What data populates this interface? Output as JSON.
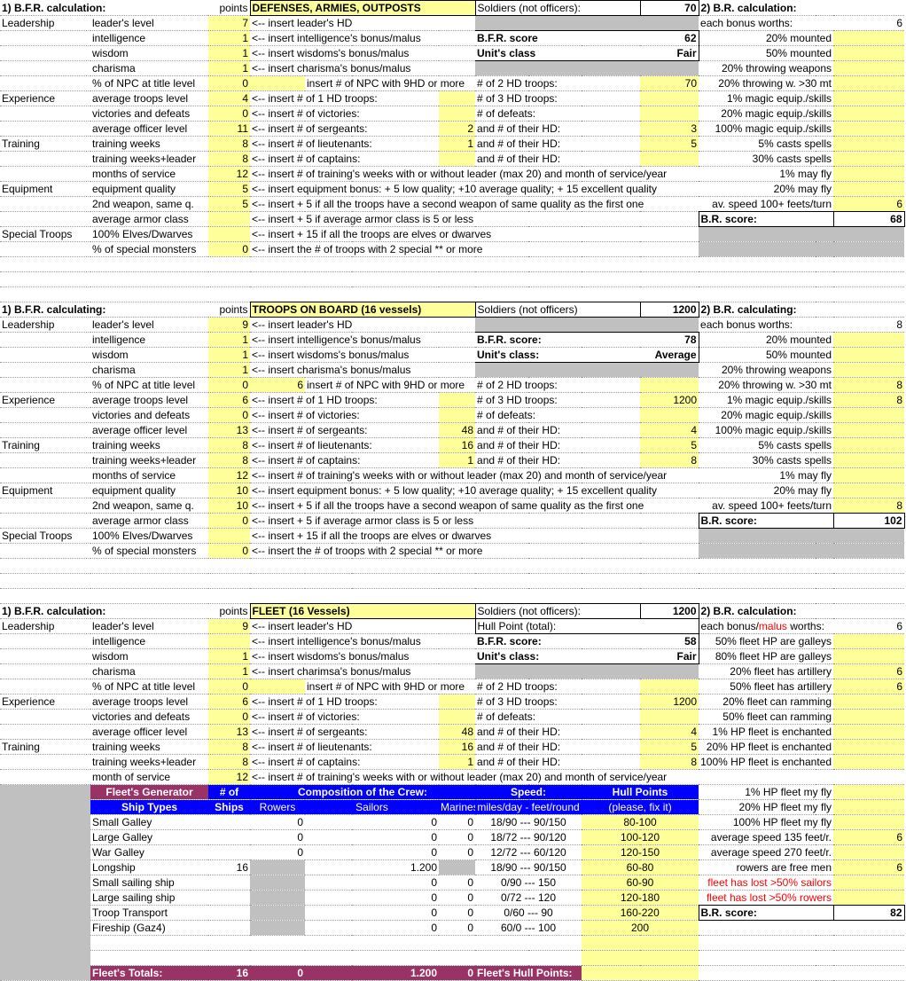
{
  "sections": [
    {
      "title": "1) B.F.R. calculation:",
      "points_label": "points",
      "heading": "DEFENSES, ARMIES, OUTPOSTS",
      "soldiers_label": "Soldiers (not officers):",
      "soldiers": "70",
      "br_title": "2) B.R. calculation:",
      "bonus_label": "each bonus worths:",
      "bonus_value": "6",
      "bfr_score_label": "B.F.R. score",
      "bfr_score": "62",
      "unit_class_label": "Unit's class",
      "unit_class": "Fair",
      "rows": [
        {
          "cat": "Leadership",
          "item": "leader's level",
          "pts": "7",
          "ins": "<-- insert leader's HD",
          "mid_l": "",
          "mid_v": "",
          "br_l": "",
          "br_v": ""
        },
        {
          "cat": "",
          "item": "intelligence",
          "pts": "1",
          "ins": "<-- insert intelligence's bonus/malus",
          "br_l": "20% mounted",
          "br_v": ""
        },
        {
          "cat": "",
          "item": "wisdom",
          "pts": "1",
          "ins": "<-- insert wisdoms's bonus/malus",
          "br_l": "50% mounted",
          "br_v": ""
        },
        {
          "cat": "",
          "item": "charisma",
          "pts": "1",
          "ins": "<-- insert charisma's bonus/malus",
          "br_l": "20% throwing weapons",
          "br_v": ""
        },
        {
          "cat": "",
          "item": "% of NPC at title level",
          "pts": "0",
          "ins_v": "",
          "ins": "insert # of NPC with 9HD or more",
          "mid_l": "# of 2 HD troops:",
          "mid_v": "70",
          "br_l": "20% throwing w. >30 mt",
          "br_v": ""
        },
        {
          "cat": "Experience",
          "item": "average troops level",
          "pts": "4",
          "ins": "<-- insert # of 1 HD troops:",
          "ins_v": "",
          "mid_l": "# of 3 HD troops:",
          "mid_v": "",
          "br_l": "1% magic equip./skills",
          "br_v": ""
        },
        {
          "cat": "",
          "item": "victories and defeats",
          "pts": "0",
          "ins": "<-- insert # of victories:",
          "ins_v": "",
          "mid_l": "# of defeats:",
          "mid_v": "",
          "br_l": "20% magic equip./skills",
          "br_v": ""
        },
        {
          "cat": "",
          "item": "average officer level",
          "pts": "11",
          "ins": "<-- insert # of sergeants:",
          "ins_v": "2",
          "mid_l": "and # of their HD:",
          "mid_v": "3",
          "br_l": "100% magic equip./skills",
          "br_v": ""
        },
        {
          "cat": "Training",
          "item": "training weeks",
          "pts": "8",
          "ins": "<-- insert # of lieutenants:",
          "ins_v": "1",
          "mid_l": "and # of their HD:",
          "mid_v": "5",
          "br_l": "5% casts spells",
          "br_v": ""
        },
        {
          "cat": "",
          "item": "training weeks+leader",
          "pts": "8",
          "ins": "<-- insert # of captains:",
          "ins_v": "",
          "mid_l": "and # of their HD:",
          "mid_v": "",
          "br_l": "30% casts spells",
          "br_v": ""
        },
        {
          "cat": "",
          "item": "months of service",
          "pts": "12",
          "long": "<-- insert # of training's weeks with or without leader (max 20) and month of service/year",
          "br_l": "1% may fly",
          "br_v": ""
        },
        {
          "cat": "Equipment",
          "item": "equipment quality",
          "pts": "5",
          "long": "<-- insert equipment bonus: + 5 low quality; +10 average quality; + 15 excellent quality",
          "br_l": "20% may fly",
          "br_v": ""
        },
        {
          "cat": "",
          "item": "2nd weapon, same q.",
          "pts": "5",
          "long": "<-- insert + 5 if all the troops have a second weapon of same quality as the first one",
          "br_l": "av. speed 100+ feets/turn",
          "br_v": "6"
        },
        {
          "cat": "",
          "item": "average armor class",
          "pts": "",
          "long": "<-- insert + 5 if average armor class is 5 or less",
          "br_l": "B.R. score:",
          "br_v": "68"
        },
        {
          "cat": "Special Troops",
          "item": "100% Elves/Dwarves",
          "pts": "",
          "long": "<-- insert + 15 if all the troops are elves or dwarves"
        },
        {
          "cat": "",
          "item": "% of special monsters",
          "pts": "0",
          "long": "<-- insert the # of troops with 2 special ** or more"
        }
      ]
    },
    {
      "title": "1) B.F.R.  calculating:",
      "points_label": "points",
      "heading": "TROOPS ON BOARD (16 vessels)",
      "soldiers_label": "Soldiers (not officers)",
      "soldiers": "1200",
      "br_title": "2) B.R. calculating:",
      "bonus_label": "each bonus worths:",
      "bonus_value": "8",
      "bfr_score_label": "B.F.R. score:",
      "bfr_score": "78",
      "unit_class_label": "Unit's class:",
      "unit_class": "Average",
      "rows": [
        {
          "cat": "Leadership",
          "item": "leader's level",
          "pts": "9",
          "ins": "<-- insert leader's HD",
          "br_l": "",
          "br_v": ""
        },
        {
          "cat": "",
          "item": "intelligence",
          "pts": "1",
          "ins": "<-- insert intelligence's bonus/malus",
          "br_l": "20% mounted",
          "br_v": ""
        },
        {
          "cat": "",
          "item": "wisdom",
          "pts": "1",
          "ins": "<-- insert wisdoms's bonus/malus",
          "br_l": "50% mounted",
          "br_v": ""
        },
        {
          "cat": "",
          "item": "charisma",
          "pts": "1",
          "ins": "<-- insert charisma's bonus/malus",
          "br_l": "20% throwing weapons",
          "br_v": ""
        },
        {
          "cat": "",
          "item": "% of NPC at title level",
          "pts": "0",
          "ins_v": "6",
          "ins": "insert # of NPC with 9HD or more",
          "mid_l": "# of 2 HD troops:",
          "mid_v": "",
          "br_l": "20% throwing w. >30 mt",
          "br_v": "8"
        },
        {
          "cat": "Experience",
          "item": "average troops level",
          "pts": "6",
          "ins": "<-- insert # of 1 HD troops:",
          "ins_v": "",
          "mid_l": "# of 3 HD troops:",
          "mid_v": "1200",
          "br_l": "1% magic equip./skills",
          "br_v": "8"
        },
        {
          "cat": "",
          "item": "victories and defeats",
          "pts": "0",
          "ins": "<-- insert # of victories:",
          "ins_v": "",
          "mid_l": "# of defeats:",
          "mid_v": "",
          "br_l": "20% magic equip./skills",
          "br_v": ""
        },
        {
          "cat": "",
          "item": "average officer level",
          "pts": "13",
          "ins": "<-- insert # of sergeants:",
          "ins_v": "48",
          "mid_l": "and # of their HD:",
          "mid_v": "4",
          "br_l": "100% magic equip./skills",
          "br_v": ""
        },
        {
          "cat": "Training",
          "item": "training weeks",
          "pts": "8",
          "ins": "<-- insert # of lieutenants:",
          "ins_v": "16",
          "mid_l": "and # of their HD:",
          "mid_v": "5",
          "br_l": "5% casts spells",
          "br_v": ""
        },
        {
          "cat": "",
          "item": "training weeks+leader",
          "pts": "8",
          "ins": "<-- insert # of captains:",
          "ins_v": "1",
          "mid_l": "and # of their HD:",
          "mid_v": "8",
          "br_l": "30% casts spells",
          "br_v": ""
        },
        {
          "cat": "",
          "item": "months of service",
          "pts": "12",
          "long": "<-- insert # of training's weeks with or without leader (max 20) and month of service/year",
          "br_l": "1% may fly",
          "br_v": ""
        },
        {
          "cat": "Equipment",
          "item": "equipment quality",
          "pts": "10",
          "long": "<-- insert equipment bonus: + 5 low quality; +10 average quality; + 15 excellent quality",
          "br_l": "20% may fly",
          "br_v": ""
        },
        {
          "cat": "",
          "item": "2nd weapon, same q.",
          "pts": "10",
          "long": "<-- insert + 5 if all the troops have a second weapon of same quality as the first one",
          "br_l": "av. speed 100+ feets/turn",
          "br_v": "8"
        },
        {
          "cat": "",
          "item": "average armor class",
          "pts": "0",
          "long": "<-- insert + 5 if average armor class is 5 or less",
          "br_l": "B.R. score:",
          "br_v": "102"
        },
        {
          "cat": "Special Troops",
          "item": "100% Elves/Dwarves",
          "pts": "",
          "long": "<-- insert + 15 if all the troops are elves or dwarves"
        },
        {
          "cat": "",
          "item": "% of special monsters",
          "pts": "0",
          "long": "<-- insert the # of troops with 2 special ** or more"
        }
      ]
    },
    {
      "title": "1) B.F.R. calculation:",
      "points_label": "points",
      "heading": "FLEET (16 Vessels)",
      "soldiers_label": "Soldiers (not officers):",
      "soldiers": "1200",
      "hull_label": "Hull Point (total):",
      "br_title": "2) B.R. calculation:",
      "bonus_label_a": "each bonus/",
      "bonus_label_b": "malus",
      "bonus_label_c": " worths:",
      "bonus_value": "6",
      "bfr_score_label": "B.F.R. score:",
      "bfr_score": "58",
      "unit_class_label": "Unit's class:",
      "unit_class": "Fair",
      "rows": [
        {
          "cat": "Leadership",
          "item": "leader's level",
          "pts": "9",
          "ins": "<-- insert leader's HD",
          "br_l": "20% fleet HP are galleys",
          "br_v": ""
        },
        {
          "cat": "",
          "item": "intelligence",
          "pts": "",
          "ins": "<-- insert intelligence's bonus/malus",
          "br_l": "50% fleet HP are galleys",
          "br_v": ""
        },
        {
          "cat": "",
          "item": "wisdom",
          "pts": "1",
          "ins": "<-- insert wisdoms's bonus/malus",
          "br_l": "80% fleet HP are galleys",
          "br_v": ""
        },
        {
          "cat": "",
          "item": "charisma",
          "pts": "1",
          "ins": "<-- insert charimsa's bonus/malus",
          "br_l": "20% fleet has artillery",
          "br_v": "6"
        },
        {
          "cat": "",
          "item": "% of NPC at title level",
          "pts": "0",
          "ins_v": "",
          "ins": "insert # of NPC with 9HD or more",
          "mid_l": "# of 2 HD troops:",
          "mid_v": "",
          "br_l": "50% fleet has artillery",
          "br_v": "6"
        },
        {
          "cat": "Experience",
          "item": "average troops level",
          "pts": "6",
          "ins": "<-- insert # of 1 HD troops:",
          "ins_v": "",
          "mid_l": "# of 3 HD troops:",
          "mid_v": "1200",
          "br_l": "20% fleet can ramming",
          "br_v": ""
        },
        {
          "cat": "",
          "item": "victories and defeats",
          "pts": "0",
          "ins": "<-- insert # of victories:",
          "ins_v": "",
          "mid_l": "# of defeats:",
          "mid_v": "",
          "br_l": "50% fleet can ramming",
          "br_v": ""
        },
        {
          "cat": "",
          "item": "average officer level",
          "pts": "13",
          "ins": "<-- insert # of sergeants:",
          "ins_v": "48",
          "mid_l": "and # of their HD:",
          "mid_v": "4",
          "br_l": "1% HP fleet is enchanted",
          "br_v": ""
        },
        {
          "cat": "Training",
          "item": "training weeks",
          "pts": "8",
          "ins": "<-- insert # of lieutenants:",
          "ins_v": "16",
          "mid_l": "and # of their HD:",
          "mid_v": "5",
          "br_l": "20% HP fleet is enchanted",
          "br_v": ""
        },
        {
          "cat": "",
          "item": "training weeks+leader",
          "pts": "8",
          "ins": "<-- insert # of captains:",
          "ins_v": "1",
          "mid_l": "and # of their HD:",
          "mid_v": "8",
          "br_l": "100% HP fleet is enchanted",
          "br_v": ""
        },
        {
          "cat": "",
          "item": "month of service",
          "pts": "12",
          "long": "<-- insert # of training's weeks with or without leader (max 20) and month of service/year"
        }
      ],
      "right_extra": [
        {
          "l": "1% HP fleet my fly",
          "v": ""
        },
        {
          "l": "20% HP fleet my fly",
          "v": ""
        },
        {
          "l": "100% HP fleet my fly",
          "v": ""
        },
        {
          "l": "average speed 135 feet/r.",
          "v": "6"
        },
        {
          "l": "average speed 270 feet/r.",
          "v": ""
        },
        {
          "l": "rowers are free men",
          "v": "6"
        },
        {
          "l": "fleet has lost >50% sailors",
          "v": "",
          "red": true
        },
        {
          "l": "fleet has lost >50% rowers",
          "v": "",
          "red": true
        },
        {
          "l": "B.R. score:",
          "v": "82",
          "score": true
        }
      ]
    }
  ],
  "generator": {
    "title": "Fleet's Generator",
    "ships_hdr_a": "# of",
    "ships_hdr_b": "Ships",
    "types_hdr": "Ship Types",
    "crew_hdr": "Composition of the Crew:",
    "rowers_hdr": "Rowers",
    "sailors_hdr": "Sailors",
    "marines_hdr": "Marines",
    "speed_hdr": "Speed:",
    "speed_sub": "miles/day - feet/round",
    "hull_hdr": "Hull Points",
    "hull_sub": "(please, fix it)",
    "ships": [
      {
        "name": "Small Galley",
        "n": "",
        "rowers": "0",
        "sailors": "0",
        "marines": "0",
        "speed": "18/90 --- 90/150",
        "hull": "80-100"
      },
      {
        "name": "Large Galley",
        "n": "",
        "rowers": "0",
        "sailors": "0",
        "marines": "0",
        "speed": "18/72 --- 90/120",
        "hull": "100-120"
      },
      {
        "name": "War Galley",
        "n": "",
        "rowers": "0",
        "sailors": "0",
        "marines": "0",
        "speed": "12/72 --- 60/120",
        "hull": "120-150"
      },
      {
        "name": "Longship",
        "n": "16",
        "rowers": "",
        "sailors": "1.200",
        "marines": "",
        "speed": "18/90 --- 90/150",
        "hull": "60-80",
        "grey": true
      },
      {
        "name": "Small sailing ship",
        "n": "",
        "rowers": "",
        "sailors": "0",
        "marines": "0",
        "speed": "0/90 --- 150",
        "hull": "60-90",
        "greyr": true
      },
      {
        "name": "Large sailing ship",
        "n": "",
        "rowers": "",
        "sailors": "0",
        "marines": "0",
        "speed": "0/72 --- 120",
        "hull": "120-180",
        "greyr": true
      },
      {
        "name": "Troop Transport",
        "n": "",
        "rowers": "",
        "sailors": "0",
        "marines": "0",
        "speed": "0/60 ---   90",
        "hull": "160-220",
        "greyr": true
      },
      {
        "name": "Fireship (Gaz4)",
        "n": "",
        "rowers": "",
        "sailors": "0",
        "marines": "0",
        "speed": "60/0 --- 100",
        "hull": "200",
        "greyr": true
      }
    ],
    "totals_label": "Fleet's Totals:",
    "tot_ships": "16",
    "tot_rowers": "0",
    "tot_sailors": "1.200",
    "tot_marines": "0",
    "hull_total_label": "Fleet's Hull Points:"
  }
}
